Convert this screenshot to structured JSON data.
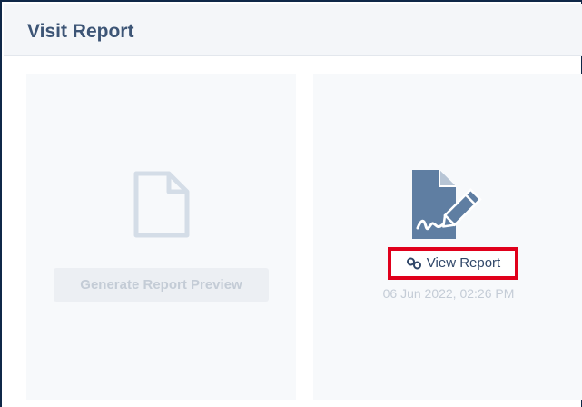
{
  "panel": {
    "title": "Visit Report"
  },
  "left_card": {
    "icon": "document-icon",
    "button_label": "Generate Report Preview"
  },
  "right_card": {
    "icon": "signed-document-icon",
    "link_icon": "link-icon",
    "link_label": "View Report",
    "timestamp": "06 Jun 2022, 02:26 PM"
  },
  "colors": {
    "title": "#3d5576",
    "icon_active": "#5f7ea2",
    "icon_disabled": "#d4dde7",
    "highlight_border": "#e0001b",
    "link_text": "#2f4668",
    "muted_text": "#c4ccd6"
  }
}
